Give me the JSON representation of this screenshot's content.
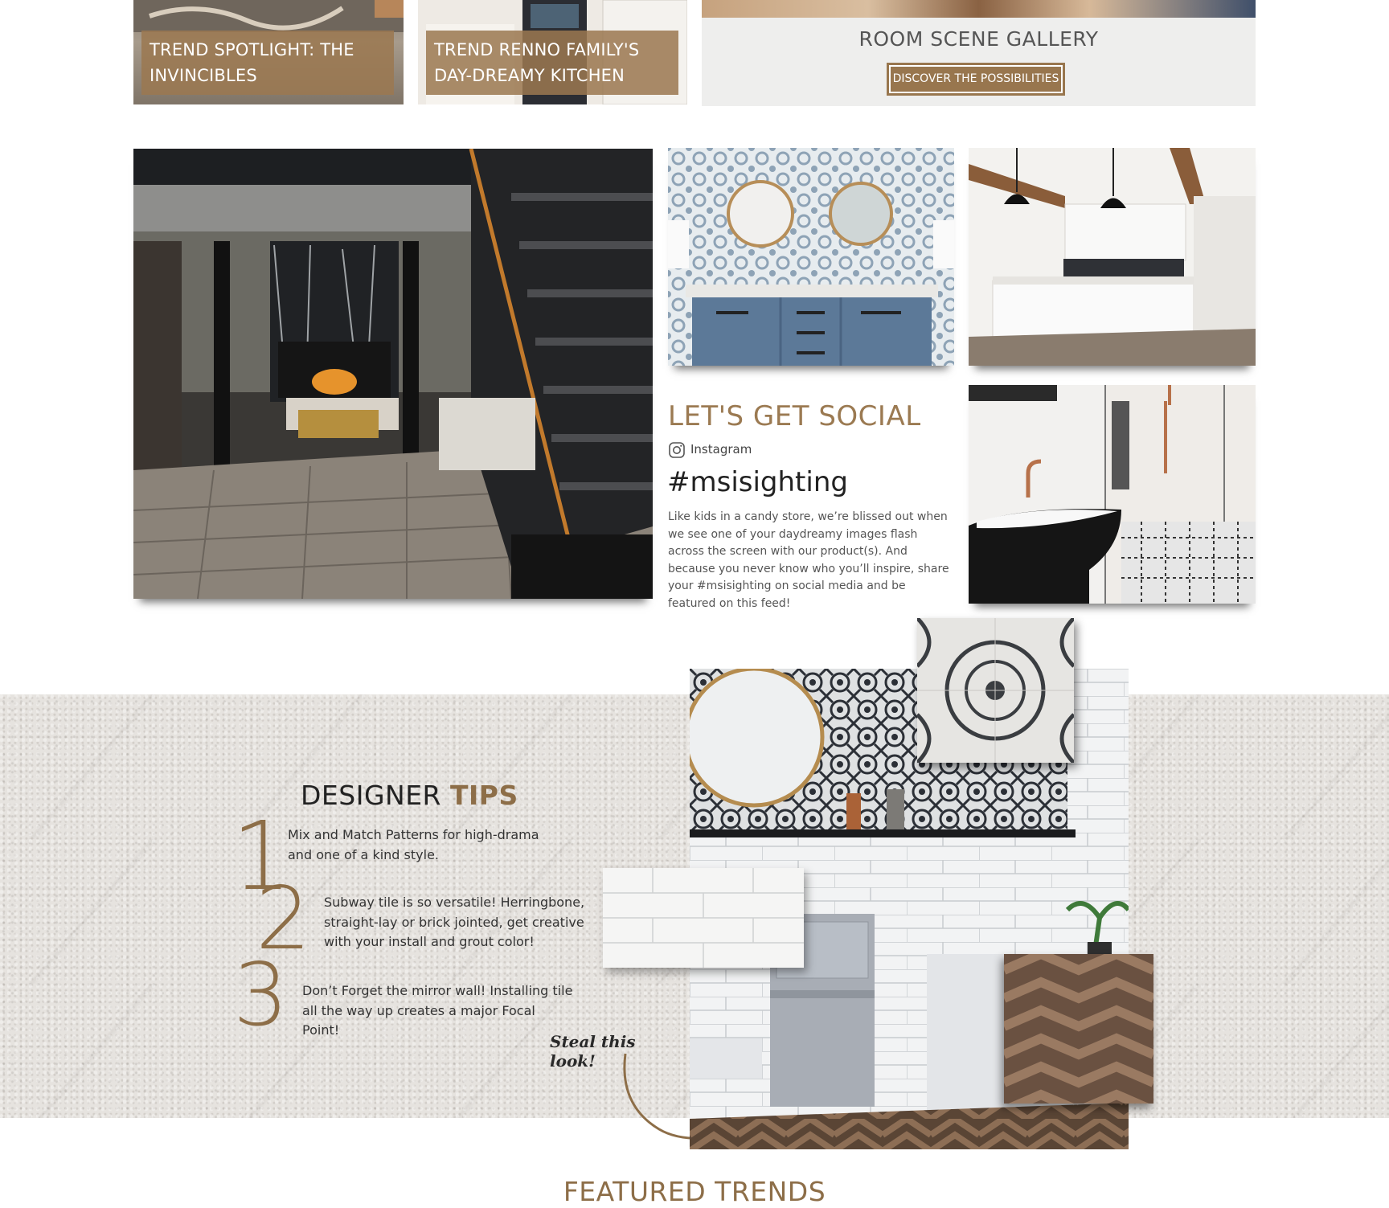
{
  "top_cards": [
    {
      "label": "TREND SPOTLIGHT: THE INVINCIBLES"
    },
    {
      "label": "TREND RENNO FAMILY'S DAY-DREAMY KITCHEN"
    }
  ],
  "gallery": {
    "title": "ROOM SCENE GALLERY",
    "button_label": "DISCOVER THE POSSIBILITIES"
  },
  "social": {
    "title": "LET'S GET SOCIAL",
    "platform": "Instagram",
    "platform_icon": "instagram-icon",
    "hashtag": "#msisighting",
    "body": "Like kids in a candy store, we’re blissed out when we see one of your daydreamy images flash across the screen with our product(s). And because you never know who you’ll inspire, share your #msisighting on social media and be featured on this feed!"
  },
  "tips": {
    "title_plain": "DESIGNER ",
    "title_accent": "TIPS",
    "items": [
      {
        "number": "1",
        "line1": "Mix and Match Patterns for high-drama",
        "line2": "and one of a kind style."
      },
      {
        "number": "2",
        "line1": "Subway tile is so versatile! Herringbone,",
        "line2": "straight-lay or brick jointed, get creative",
        "line3": "with your install and grout color!"
      },
      {
        "number": "3",
        "line1": "Don’t Forget the mirror wall! Installing tile",
        "line2": "all the way up creates a major Focal Point!"
      }
    ],
    "steal_label": "Steal this look!"
  },
  "featured_title": "FEATURED TRENDS",
  "colors": {
    "accent_brown": "#98764e",
    "text_brown": "#8d6e48",
    "granite_bg": "#e6e3df"
  }
}
